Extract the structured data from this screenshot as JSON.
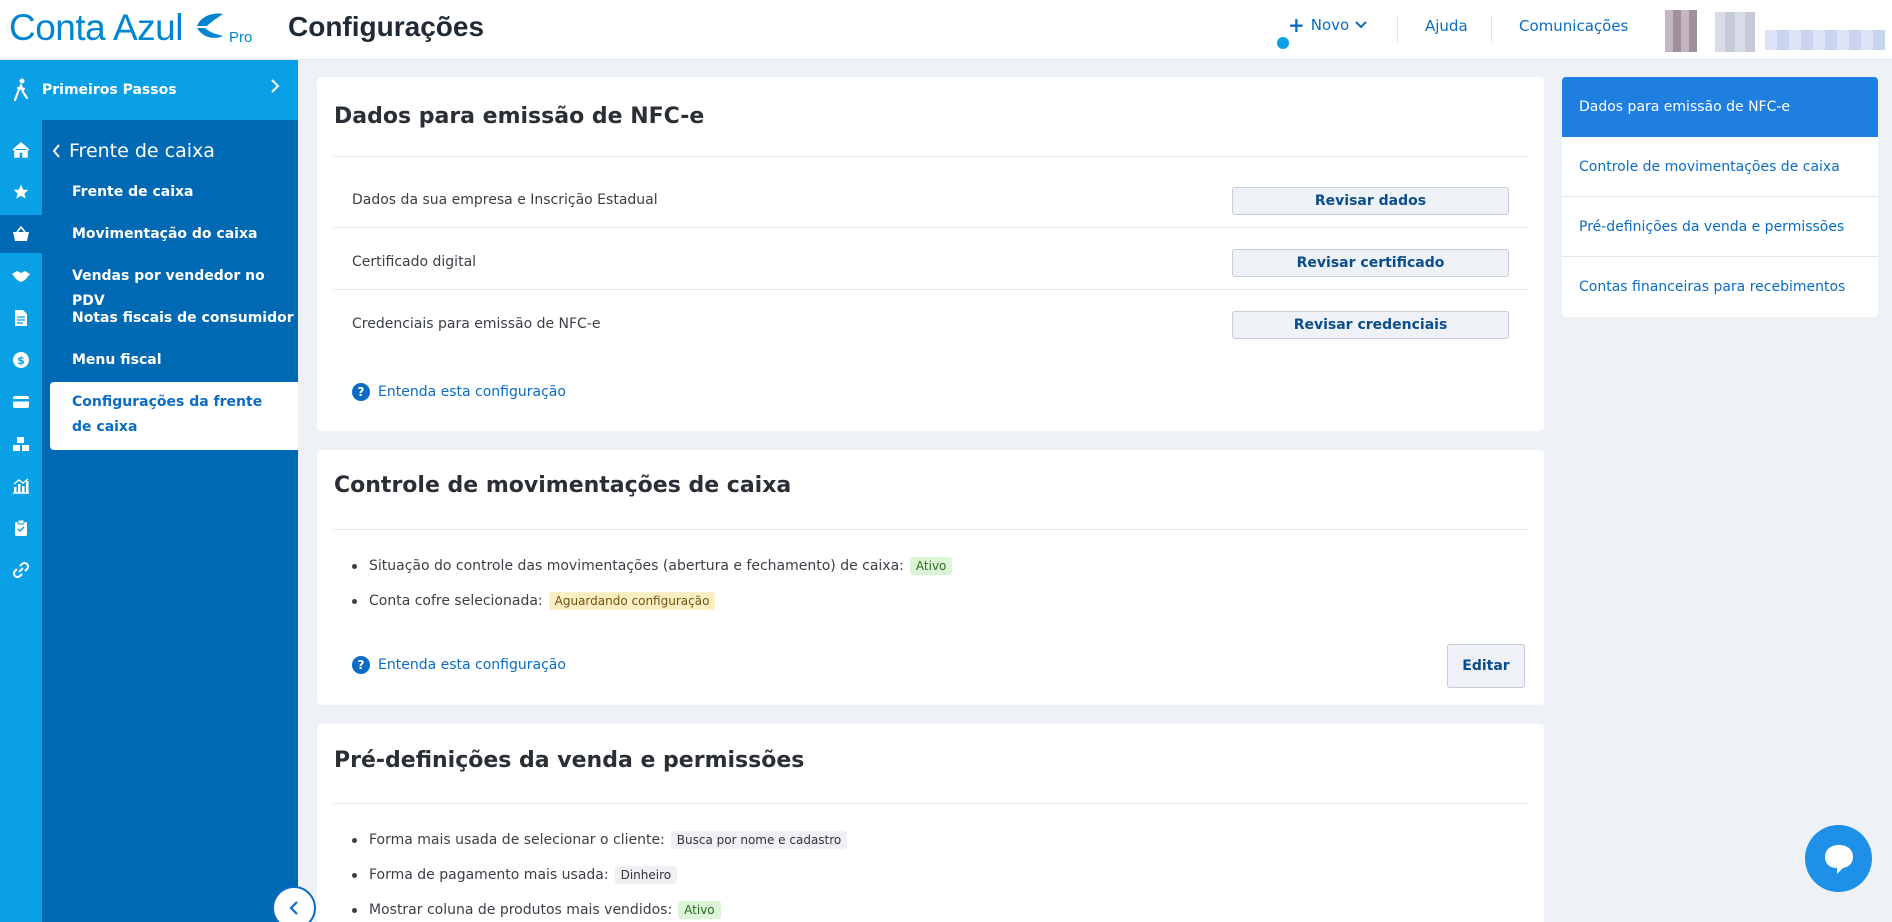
{
  "header": {
    "logo_text": "Conta Azul",
    "logo_badge": "Pro",
    "title": "Configurações",
    "new_label": "Novo",
    "help_label": "Ajuda",
    "comms_label": "Comunicações"
  },
  "rail": {
    "first_steps_label": "Primeiros Passos",
    "icons": [
      "home-icon",
      "star-icon",
      "basket-icon",
      "handshake-icon",
      "document-icon",
      "dollar-icon",
      "card-icon",
      "boxes-icon",
      "chart-icon",
      "clipboard-icon",
      "link-icon"
    ]
  },
  "subnav": {
    "back_label": "Frente de caixa",
    "items": [
      {
        "label": "Frente de caixa"
      },
      {
        "label": "Movimentação do caixa"
      },
      {
        "label": "Vendas por vendedor no PDV"
      },
      {
        "label": "Notas fiscais de consumidor"
      },
      {
        "label": "Menu fiscal"
      }
    ],
    "active_label": "Configurações da frente de caixa"
  },
  "nfce": {
    "title": "Dados para emissão de NFC-e",
    "rows": [
      {
        "label": "Dados da sua empresa e Inscrição Estadual",
        "button": "Revisar dados"
      },
      {
        "label": "Certificado digital",
        "button": "Revisar certificado"
      },
      {
        "label": "Credenciais para emissão de NFC-e",
        "button": "Revisar credenciais"
      }
    ],
    "help_label": "Entenda esta configuração"
  },
  "cash_control": {
    "title": "Controle de movimentações de caixa",
    "bullets": [
      {
        "text": "Situação do controle das movimentações (abertura e fechamento) de caixa:",
        "badge": "Ativo",
        "badge_color": "#dcf5d6"
      },
      {
        "text": "Conta cofre selecionada:",
        "badge": "Aguardando configuração",
        "badge_color": "#fcefc4"
      }
    ],
    "help_label": "Entenda esta configuração",
    "edit_label": "Editar"
  },
  "sale_defaults": {
    "title": "Pré-definições da venda e permissões",
    "bullets": [
      {
        "text": "Forma mais usada de selecionar o cliente:",
        "badge": "Busca por nome e cadastro"
      },
      {
        "text": "Forma de pagamento mais usada:",
        "badge": "Dinheiro"
      },
      {
        "text": "Mostrar coluna de produtos mais vendidos:",
        "badge": "Ativo"
      }
    ]
  },
  "anchor_nav": {
    "items": [
      {
        "label": "Dados para emissão de NFC-e",
        "active": true
      },
      {
        "label": "Controle de movimentações de caixa"
      },
      {
        "label": "Pré-definições da venda e permissões"
      },
      {
        "label": "Contas financeiras para recebimentos"
      }
    ]
  },
  "colors": {
    "brand": "#0085d1",
    "rail": "#0aa0e6",
    "subnav": "#0069b4",
    "link": "#0a6cc4",
    "active_anchor": "#1e7fe0"
  }
}
